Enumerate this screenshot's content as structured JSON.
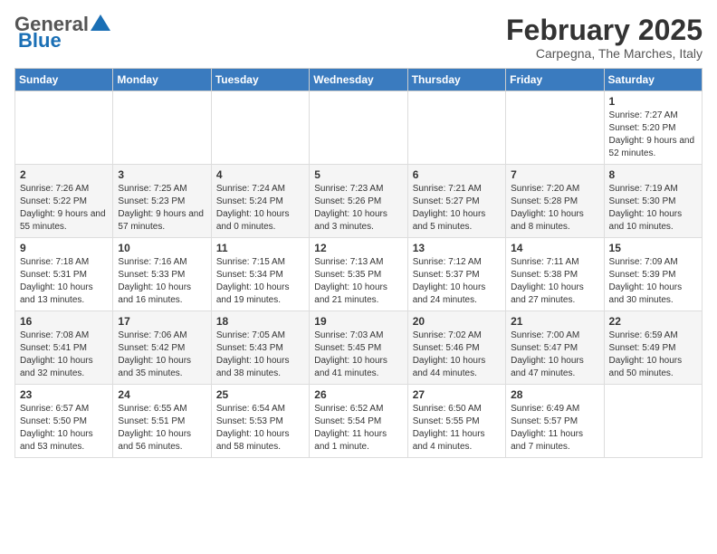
{
  "header": {
    "logo_general": "General",
    "logo_blue": "Blue",
    "month_title": "February 2025",
    "subtitle": "Carpegna, The Marches, Italy"
  },
  "weekdays": [
    "Sunday",
    "Monday",
    "Tuesday",
    "Wednesday",
    "Thursday",
    "Friday",
    "Saturday"
  ],
  "weeks": [
    [
      null,
      null,
      null,
      null,
      null,
      null,
      {
        "day": "1",
        "sunrise": "7:27 AM",
        "sunset": "5:20 PM",
        "daylight": "9 hours and 52 minutes."
      }
    ],
    [
      {
        "day": "2",
        "sunrise": "7:26 AM",
        "sunset": "5:22 PM",
        "daylight": "9 hours and 55 minutes."
      },
      {
        "day": "3",
        "sunrise": "7:25 AM",
        "sunset": "5:23 PM",
        "daylight": "9 hours and 57 minutes."
      },
      {
        "day": "4",
        "sunrise": "7:24 AM",
        "sunset": "5:24 PM",
        "daylight": "10 hours and 0 minutes."
      },
      {
        "day": "5",
        "sunrise": "7:23 AM",
        "sunset": "5:26 PM",
        "daylight": "10 hours and 3 minutes."
      },
      {
        "day": "6",
        "sunrise": "7:21 AM",
        "sunset": "5:27 PM",
        "daylight": "10 hours and 5 minutes."
      },
      {
        "day": "7",
        "sunrise": "7:20 AM",
        "sunset": "5:28 PM",
        "daylight": "10 hours and 8 minutes."
      },
      {
        "day": "8",
        "sunrise": "7:19 AM",
        "sunset": "5:30 PM",
        "daylight": "10 hours and 10 minutes."
      }
    ],
    [
      {
        "day": "9",
        "sunrise": "7:18 AM",
        "sunset": "5:31 PM",
        "daylight": "10 hours and 13 minutes."
      },
      {
        "day": "10",
        "sunrise": "7:16 AM",
        "sunset": "5:33 PM",
        "daylight": "10 hours and 16 minutes."
      },
      {
        "day": "11",
        "sunrise": "7:15 AM",
        "sunset": "5:34 PM",
        "daylight": "10 hours and 19 minutes."
      },
      {
        "day": "12",
        "sunrise": "7:13 AM",
        "sunset": "5:35 PM",
        "daylight": "10 hours and 21 minutes."
      },
      {
        "day": "13",
        "sunrise": "7:12 AM",
        "sunset": "5:37 PM",
        "daylight": "10 hours and 24 minutes."
      },
      {
        "day": "14",
        "sunrise": "7:11 AM",
        "sunset": "5:38 PM",
        "daylight": "10 hours and 27 minutes."
      },
      {
        "day": "15",
        "sunrise": "7:09 AM",
        "sunset": "5:39 PM",
        "daylight": "10 hours and 30 minutes."
      }
    ],
    [
      {
        "day": "16",
        "sunrise": "7:08 AM",
        "sunset": "5:41 PM",
        "daylight": "10 hours and 32 minutes."
      },
      {
        "day": "17",
        "sunrise": "7:06 AM",
        "sunset": "5:42 PM",
        "daylight": "10 hours and 35 minutes."
      },
      {
        "day": "18",
        "sunrise": "7:05 AM",
        "sunset": "5:43 PM",
        "daylight": "10 hours and 38 minutes."
      },
      {
        "day": "19",
        "sunrise": "7:03 AM",
        "sunset": "5:45 PM",
        "daylight": "10 hours and 41 minutes."
      },
      {
        "day": "20",
        "sunrise": "7:02 AM",
        "sunset": "5:46 PM",
        "daylight": "10 hours and 44 minutes."
      },
      {
        "day": "21",
        "sunrise": "7:00 AM",
        "sunset": "5:47 PM",
        "daylight": "10 hours and 47 minutes."
      },
      {
        "day": "22",
        "sunrise": "6:59 AM",
        "sunset": "5:49 PM",
        "daylight": "10 hours and 50 minutes."
      }
    ],
    [
      {
        "day": "23",
        "sunrise": "6:57 AM",
        "sunset": "5:50 PM",
        "daylight": "10 hours and 53 minutes."
      },
      {
        "day": "24",
        "sunrise": "6:55 AM",
        "sunset": "5:51 PM",
        "daylight": "10 hours and 56 minutes."
      },
      {
        "day": "25",
        "sunrise": "6:54 AM",
        "sunset": "5:53 PM",
        "daylight": "10 hours and 58 minutes."
      },
      {
        "day": "26",
        "sunrise": "6:52 AM",
        "sunset": "5:54 PM",
        "daylight": "11 hours and 1 minute."
      },
      {
        "day": "27",
        "sunrise": "6:50 AM",
        "sunset": "5:55 PM",
        "daylight": "11 hours and 4 minutes."
      },
      {
        "day": "28",
        "sunrise": "6:49 AM",
        "sunset": "5:57 PM",
        "daylight": "11 hours and 7 minutes."
      },
      null
    ]
  ]
}
